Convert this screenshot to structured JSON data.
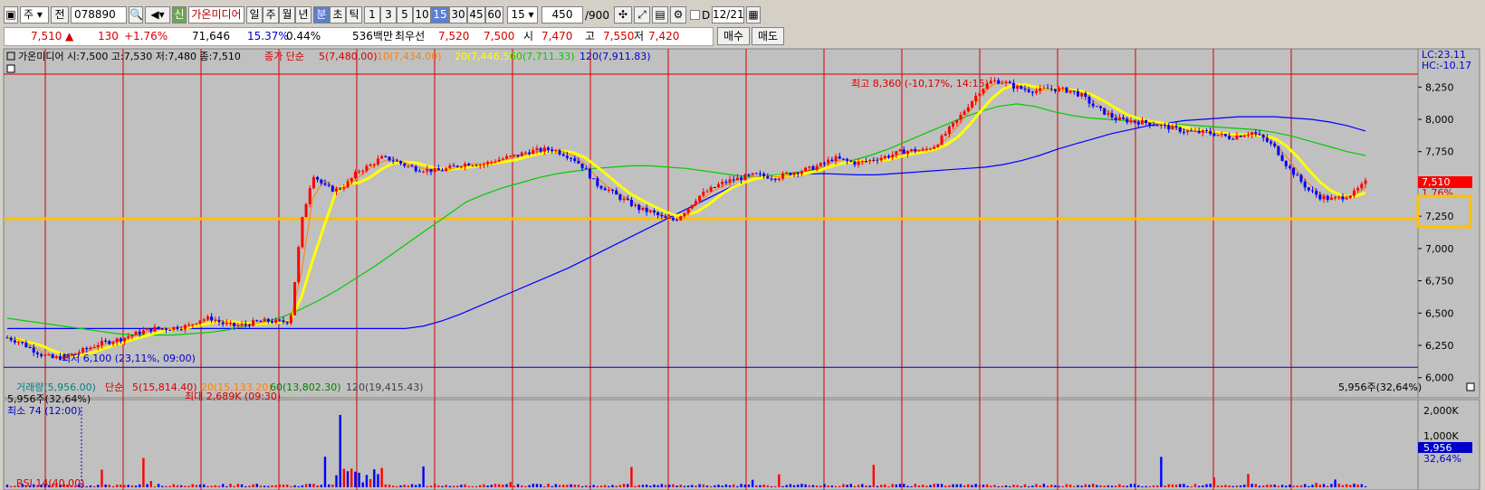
{
  "toolbar": {
    "market": "주",
    "prev_btn": "전",
    "code": "078890",
    "name": "가온미디어",
    "tab_day": "일",
    "tab_week": "주",
    "tab_month": "월",
    "tab_year": "년",
    "tab_min": "분",
    "tab_sec": "초",
    "tab_tick": "틱",
    "periods": [
      "1",
      "3",
      "5",
      "10",
      "15",
      "30",
      "45",
      "60"
    ],
    "selected_period": "15",
    "period_select": "15",
    "count": "450",
    "count_total": "/900",
    "d_label": "D",
    "date": "12/21",
    "new_badge": "신"
  },
  "quote": {
    "price": "7,510",
    "arrow": "▲",
    "change": "130",
    "change_pct": "+1.76%",
    "volume": "71,646",
    "turnover_pct": "15.37%",
    "ratio": "0.44%",
    "amount": "536백만",
    "priority_label": "최우선",
    "priority_ask": "7,520",
    "priority_bid": "7,500",
    "open_label": "시",
    "open": "7,470",
    "high_label": "고",
    "high": "7,550",
    "low_label": "저",
    "low": "7,420",
    "buy_btn": "매수",
    "sell_btn": "매도"
  },
  "price_legend": {
    "summary": "가온미디어 시:7,500 고:7,530 저:7,480 종:7,510",
    "ma_prefix": "종가 단순",
    "ma5": "5(7,480.00)",
    "ma10": "10(7,434.00)",
    "ma20": "20(7,446.50)",
    "ma60": "60(7,711.33)",
    "ma120": "120(7,911.83)"
  },
  "annotations": {
    "high": "최고 8,360 (-10,17%, 14:15)",
    "low": "최저 6,100 (23,11%, 09:00)",
    "lc": "LC:23.11",
    "hc": "HC:-10.17",
    "last_price": "7,510",
    "last_pct": "1.76%"
  },
  "volume_legend": {
    "vol": "거래량(5,956.00)",
    "ma_prefix": "단순",
    "ma5": "5(15,814.40)",
    "ma20": "20(15,133.20)",
    "ma60": "60(13,802.30)",
    "ma120": "120(19,415.43)",
    "current": "5,956주(32,64%)",
    "current_right": "5,956주(32,64%)",
    "max": "최대 2,689K (09:30)",
    "min": "최소 74 (12:00)",
    "axis_2000": "2,000K",
    "axis_1000": "1,000K",
    "last_vol": "5,956",
    "last_vol_pct": "32,64%"
  },
  "rsi_label": "RSI 14(40.00)",
  "colors": {
    "chart_bg": "#c0c0c0",
    "up": "#ff0000",
    "down": "#0000ff",
    "ma5": "#ff0000",
    "ma10": "#ff8000",
    "ma20": "#ffff00",
    "ma60": "#00cc00",
    "ma120": "#0000ff",
    "support": "#ffc000"
  },
  "chart_data": {
    "type": "candlestick",
    "title": "가온미디어 15분",
    "y_ticks": [
      8250,
      8000,
      7750,
      7500,
      7250,
      7000,
      6750,
      6500,
      6250,
      6000
    ],
    "y_tick_labels": [
      "8,250",
      "8,000",
      "7,750",
      "7,500",
      "7,250",
      "7,000",
      "6,750",
      "6,500",
      "6,250",
      "6,000"
    ],
    "ylim": [
      5970,
      8420
    ],
    "close_path": [
      6310,
      6280,
      6230,
      6180,
      6150,
      6160,
      6190,
      6220,
      6260,
      6280,
      6300,
      6330,
      6360,
      6380,
      6380,
      6390,
      6400,
      6450,
      6460,
      6420,
      6400,
      6410,
      6430,
      6440,
      6430,
      6440,
      7200,
      7580,
      7480,
      7450,
      7500,
      7600,
      7640,
      7700,
      7690,
      7650,
      7620,
      7610,
      7600,
      7620,
      7650,
      7660,
      7650,
      7680,
      7700,
      7720,
      7750,
      7760,
      7770,
      7740,
      7700,
      7620,
      7500,
      7460,
      7400,
      7350,
      7300,
      7280,
      7230,
      7220,
      7300,
      7400,
      7450,
      7500,
      7530,
      7550,
      7570,
      7560,
      7550,
      7580,
      7600,
      7620,
      7650,
      7700,
      7680,
      7660,
      7680,
      7700,
      7720,
      7750,
      7760,
      7760,
      7800,
      7900,
      8000,
      8120,
      8230,
      8300,
      8290,
      8250,
      8230,
      8220,
      8240,
      8230,
      8220,
      8180,
      8100,
      8050,
      8000,
      7990,
      7980,
      7970,
      7950,
      7930,
      7910,
      7900,
      7900,
      7880,
      7860,
      7880,
      7900,
      7850,
      7780,
      7650,
      7550,
      7450,
      7400,
      7380,
      7400,
      7430,
      7510
    ],
    "ma60": [
      6460,
      6440,
      6420,
      6400,
      6380,
      6360,
      6340,
      6330,
      6330,
      6330,
      6340,
      6350,
      6370,
      6400,
      6430,
      6470,
      6530,
      6600,
      6680,
      6770,
      6860,
      6960,
      7060,
      7160,
      7260,
      7360,
      7420,
      7470,
      7510,
      7550,
      7580,
      7600,
      7620,
      7630,
      7640,
      7640,
      7630,
      7620,
      7600,
      7580,
      7560,
      7560,
      7570,
      7590,
      7610,
      7640,
      7680,
      7720,
      7770,
      7830,
      7890,
      7950,
      8010,
      8060,
      8100,
      8120,
      8100,
      8060,
      8030,
      8010,
      8000,
      7990,
      7980,
      7970,
      7960,
      7950,
      7940,
      7930,
      7920,
      7900,
      7870,
      7830,
      7790,
      7750,
      7720
    ],
    "ma120": [
      6380,
      6380,
      6380,
      6380,
      6380,
      6380,
      6380,
      6380,
      6380,
      6380,
      6380,
      6380,
      6380,
      6380,
      6380,
      6380,
      6380,
      6380,
      6380,
      6380,
      6380,
      6380,
      6380,
      6400,
      6440,
      6490,
      6550,
      6610,
      6670,
      6730,
      6790,
      6850,
      6920,
      6990,
      7060,
      7130,
      7200,
      7270,
      7340,
      7410,
      7480,
      7530,
      7560,
      7570,
      7575,
      7580,
      7575,
      7570,
      7570,
      7580,
      7590,
      7600,
      7610,
      7620,
      7630,
      7650,
      7680,
      7720,
      7770,
      7810,
      7850,
      7890,
      7920,
      7950,
      7970,
      7990,
      8000,
      8010,
      8020,
      8020,
      8020,
      8010,
      8000,
      7980,
      7950,
      7910
    ],
    "support_level": 7230,
    "low_line": 6080,
    "high_line": 8350,
    "volume_spikes": {
      "max_k": 2689
    }
  }
}
